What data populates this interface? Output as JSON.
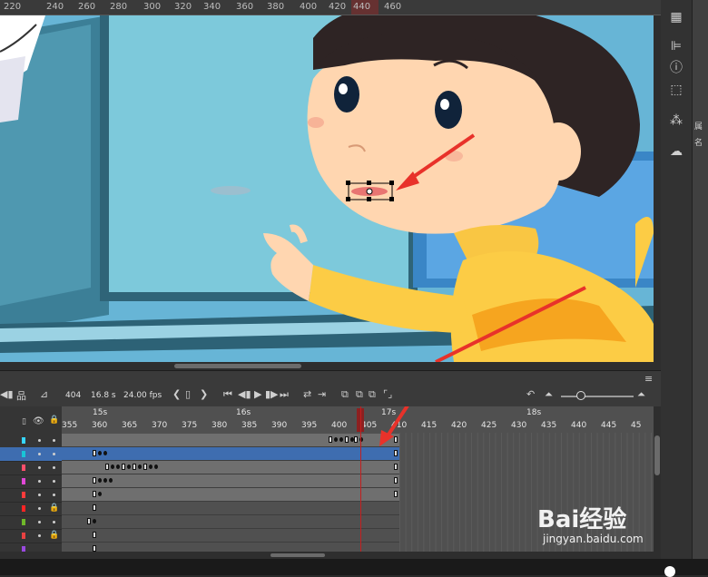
{
  "ruler": {
    "labels": [
      "220",
      "240",
      "260",
      "280",
      "300",
      "320",
      "340",
      "360",
      "380",
      "400",
      "420",
      "440",
      "460"
    ]
  },
  "timeline_toolbar": {
    "frame": "404",
    "time": "16.8 s",
    "fps": "24.00 fps"
  },
  "timeline": {
    "seconds": [
      "15s",
      "16s",
      "17s",
      "18s"
    ],
    "frame_numbers": [
      "355",
      "360",
      "365",
      "370",
      "375",
      "380",
      "385",
      "390",
      "395",
      "400",
      "405",
      "410",
      "415",
      "420",
      "425",
      "430",
      "435",
      "440",
      "445",
      "45"
    ],
    "current_frame": 404
  },
  "right_panel": {
    "side_labels": [
      "属",
      "名"
    ]
  },
  "watermark": {
    "top": "Bai经验",
    "bottom": "jingyan.baidu.com"
  },
  "colors": {
    "stage_blue": "#5fb0d2",
    "selected_layer": "#3e6db0",
    "playhead": "#c41f1f",
    "arrow": "#e8322a"
  }
}
